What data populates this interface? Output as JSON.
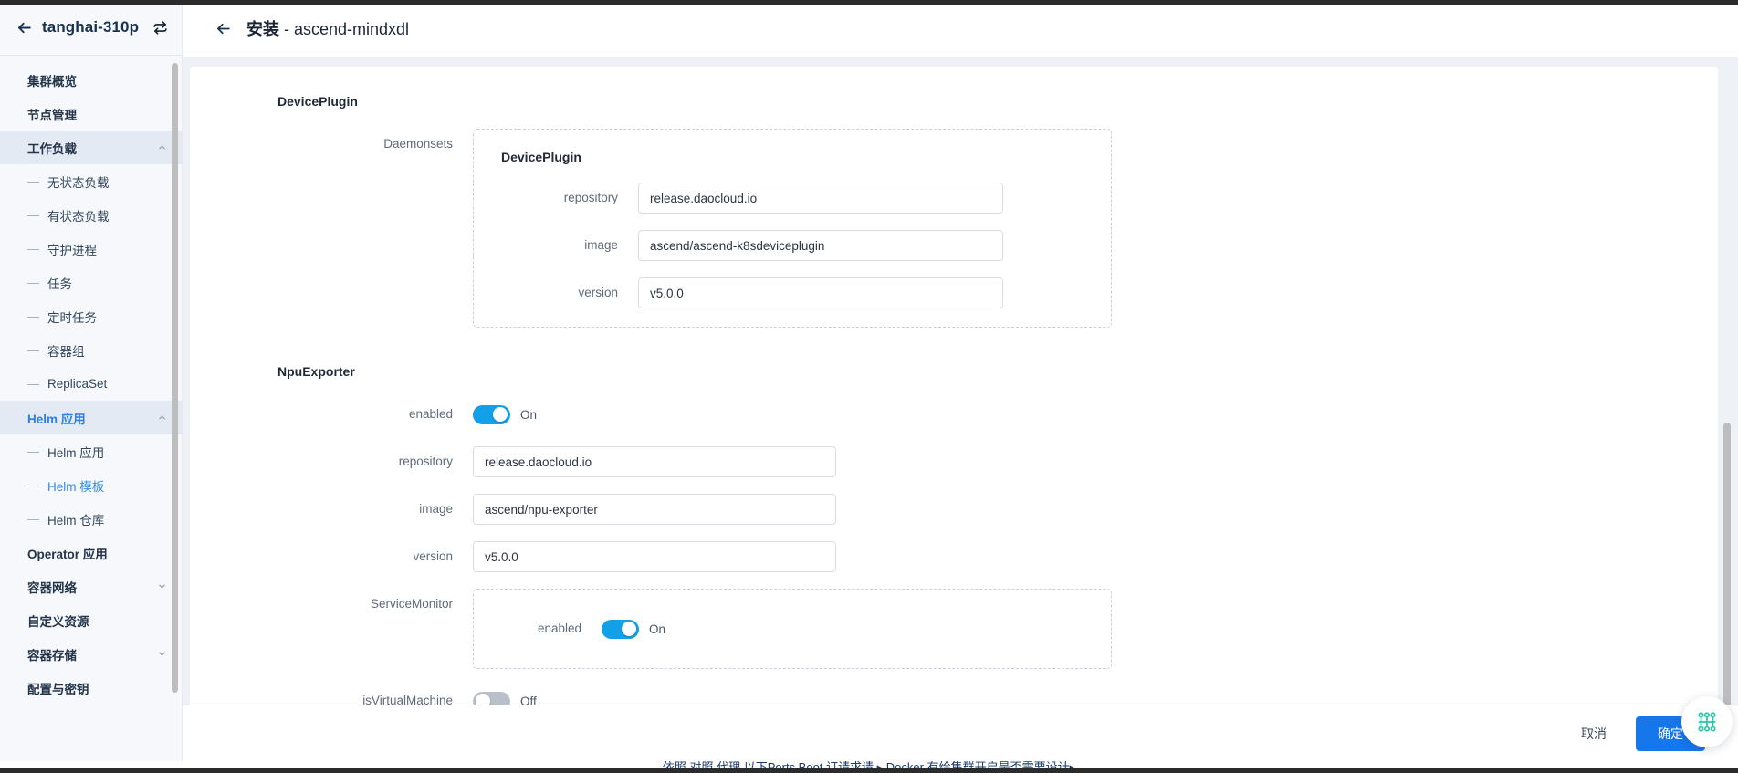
{
  "sidebar": {
    "back_icon": "arrow-left-icon",
    "cluster_name": "tanghai-310p",
    "sync_icon": "sync-icon",
    "items": [
      {
        "label": "集群概览",
        "type": "item"
      },
      {
        "label": "节点管理",
        "type": "item"
      },
      {
        "label": "工作负载",
        "type": "group",
        "state": "expanded",
        "chevron": "chevron-up-icon"
      },
      {
        "label": "无状态负载",
        "type": "sub"
      },
      {
        "label": "有状态负载",
        "type": "sub"
      },
      {
        "label": "守护进程",
        "type": "sub"
      },
      {
        "label": "任务",
        "type": "sub"
      },
      {
        "label": "定时任务",
        "type": "sub"
      },
      {
        "label": "容器组",
        "type": "sub"
      },
      {
        "label": "ReplicaSet",
        "type": "sub"
      },
      {
        "label": "Helm 应用",
        "type": "group",
        "state": "expanded",
        "chevron": "chevron-up-icon"
      },
      {
        "label": "Helm 应用",
        "type": "sub"
      },
      {
        "label": "Helm 模板",
        "type": "sub",
        "active": true
      },
      {
        "label": "Helm 仓库",
        "type": "sub"
      },
      {
        "label": "Operator 应用",
        "type": "item"
      },
      {
        "label": "容器网络",
        "type": "group",
        "state": "collapsed",
        "chevron": "chevron-down-icon"
      },
      {
        "label": "自定义资源",
        "type": "item"
      },
      {
        "label": "容器存储",
        "type": "group",
        "state": "collapsed",
        "chevron": "chevron-down-icon"
      },
      {
        "label": "配置与密钥",
        "type": "item"
      }
    ]
  },
  "header": {
    "back_icon": "arrow-left-icon",
    "title_prefix": "安装",
    "title_rest": " - ascend-mindxdl"
  },
  "form": {
    "device_plugin": {
      "section_title": "DevicePlugin",
      "daemonsets_label": "Daemonsets",
      "box_title": "DevicePlugin",
      "fields": [
        {
          "label": "repository",
          "value": "release.daocloud.io"
        },
        {
          "label": "image",
          "value": "ascend/ascend-k8sdeviceplugin"
        },
        {
          "label": "version",
          "value": "v5.0.0"
        }
      ]
    },
    "npu_exporter": {
      "section_title": "NpuExporter",
      "enabled": {
        "label": "enabled",
        "state": "On",
        "on": true
      },
      "fields": [
        {
          "label": "repository",
          "value": "release.daocloud.io"
        },
        {
          "label": "image",
          "value": "ascend/npu-exporter"
        },
        {
          "label": "version",
          "value": "v5.0.0"
        }
      ],
      "service_monitor": {
        "label": "ServiceMonitor",
        "enabled_label": "enabled",
        "state": "On",
        "on": true
      },
      "is_virtual_machine": {
        "label": "isVirtualMachine",
        "state": "Off",
        "on": false
      }
    }
  },
  "footer": {
    "cancel_label": "取消",
    "confirm_label": "确定"
  },
  "fab": {
    "icon": "circuit-assistant-icon"
  },
  "bottom_hint": "  依照 对照 代理 以下Ports Boot 订请求请 ▸ Docker 有绘集群开启是否需要设计▸ ",
  "colors": {
    "accent": "#1677ed",
    "toggle_on": "#12a1e8",
    "toggle_off": "#b9c0c9",
    "sidebar_bg": "#f6f8fb",
    "active_text": "#2e8bf0"
  }
}
